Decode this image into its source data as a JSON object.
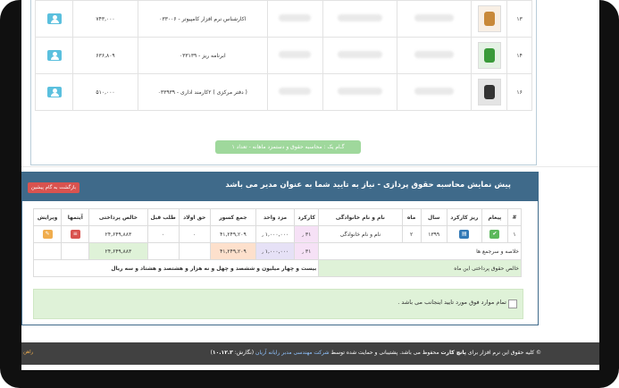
{
  "top_rows": [
    {
      "num": "۱۳",
      "text": "اکارشناس نرم افزار کامپیوتر - ۰۳۳۰۰۶",
      "amount": "۷۴۳,۰۰۰",
      "photo_icon": "logo-gold-icon",
      "photo_color": "#c8893a"
    },
    {
      "num": "۱۴",
      "text": "ابرنامه ریز - ۰۳۳۱۳۹",
      "amount": "۶۳۶,۸۰۹",
      "photo_icon": "logo-green-icon",
      "photo_color": "#3a9a3a"
    },
    {
      "num": "۱۶",
      "text": "( دفتر مرکزی ) ۲کارمند اداری - ۰۳۳۹۳۹",
      "amount": "۵۱۰,۰۰۰",
      "photo_icon": "person-photo-icon",
      "photo_color": "#333333"
    }
  ],
  "step_button": "گـام یک : محاسبه حقوق و دستمزد ماهانه - تعداد ۱",
  "panel": {
    "title": "پیش نمایش محاسبه حقوق پردازی - نیاز به تایید شما به عنوان مدیر می باشد",
    "back_button": "بازگشت به گام پیشین"
  },
  "table": {
    "headers": [
      "#",
      "پیغام",
      "ریز کارکرد",
      "سال",
      "ماه",
      "نام و نام خانوادگی",
      "کارکرد",
      "مزد واحد",
      "جمع کسور",
      "حق اولاد",
      "طلب قبل",
      "خالص پرداختی",
      "آیتمها",
      "ویرایش"
    ],
    "row": {
      "num": "۱",
      "year": "۱۳۹۹",
      "month": "۲",
      "name": "نام و نام خانوادگی",
      "work": "۳۱",
      "unit_wage": "۱,۰۰۰,۰۰۰",
      "deductions": "۴۱,۲۴۹,۲۰۹",
      "child": "۰",
      "prev": "۰",
      "net": "۲۴,۶۴۹,۸۸۳"
    },
    "summary": {
      "label": "خلاصه و سرجمع ها",
      "work": "۳۱",
      "unit_wage": "۱,۰۰۰,۰۰۰",
      "deductions": "۴۱,۲۴۹,۲۰۹",
      "net": "۲۴,۶۴۹,۸۸۳"
    },
    "words_label": "خالص حقوق پرداختی این ماه",
    "words_value": "بیست و چهار میلیون و ششصد و چهل و نه هزار و هشتصد و هشتاد و سه ریال",
    "unit_suffix": "ر"
  },
  "notice": "تمام موارد فوق مورد تایید اینجانب می باشد .",
  "footer": {
    "part1": "© کلیه حقوق این نرم افزار برای",
    "brand": "پانچ کارت",
    "part2": "محفوظ می باشد. پشتیبانی و حمایت شده توسط",
    "company": "شرکت مهندسی مدبر رایانه آریان",
    "version_label": "(نگارش:",
    "version": "۱۰.۱۲.۳",
    "version_close": ")",
    "side": "راهن"
  },
  "colors": {
    "panel_header": "#3f6a8a",
    "footer_bg": "#414141",
    "back_button": "#d9534f",
    "step_button": "#9fd89c"
  }
}
